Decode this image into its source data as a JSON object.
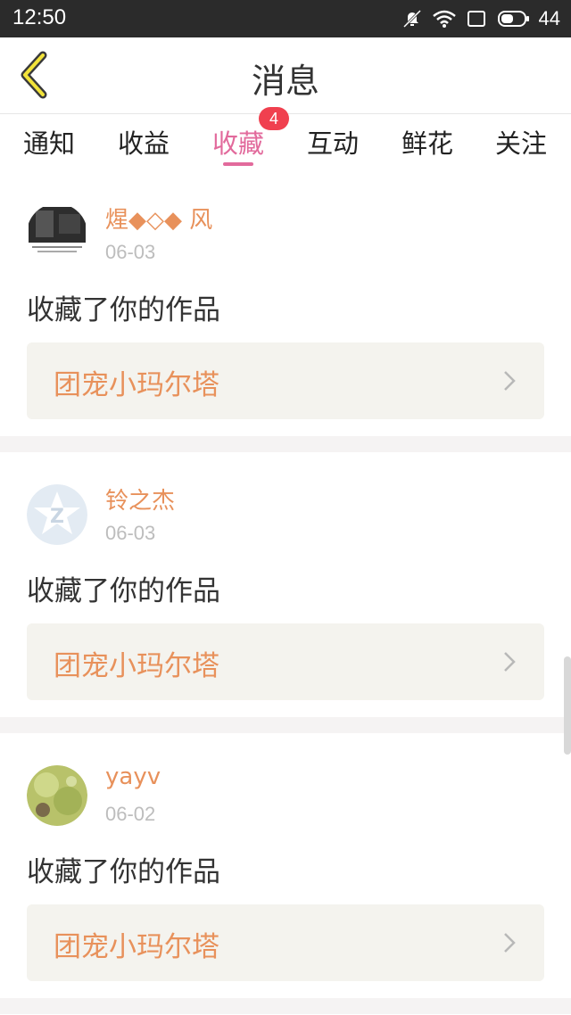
{
  "status_bar": {
    "time": "12:50",
    "battery": "44"
  },
  "header": {
    "title": "消息"
  },
  "tabs": [
    {
      "label": "通知"
    },
    {
      "label": "收益"
    },
    {
      "label": "收藏",
      "badge": "4",
      "active": true
    },
    {
      "label": "互动"
    },
    {
      "label": "鲜花"
    },
    {
      "label": "关注"
    }
  ],
  "items": [
    {
      "name": "煋◆◇◆ 风",
      "date": "06-03",
      "action": "收藏了你的作品",
      "work": "团宠小玛尔塔"
    },
    {
      "name": "铃之杰",
      "date": "06-03",
      "action": "收藏了你的作品",
      "work": "团宠小玛尔塔"
    },
    {
      "name": "yayv",
      "date": "06-02",
      "action": "收藏了你的作品",
      "work": "团宠小玛尔塔"
    }
  ],
  "colors": {
    "accent_pink": "#e26a9c",
    "orange": "#e8915b",
    "badge_red": "#f0404f"
  }
}
